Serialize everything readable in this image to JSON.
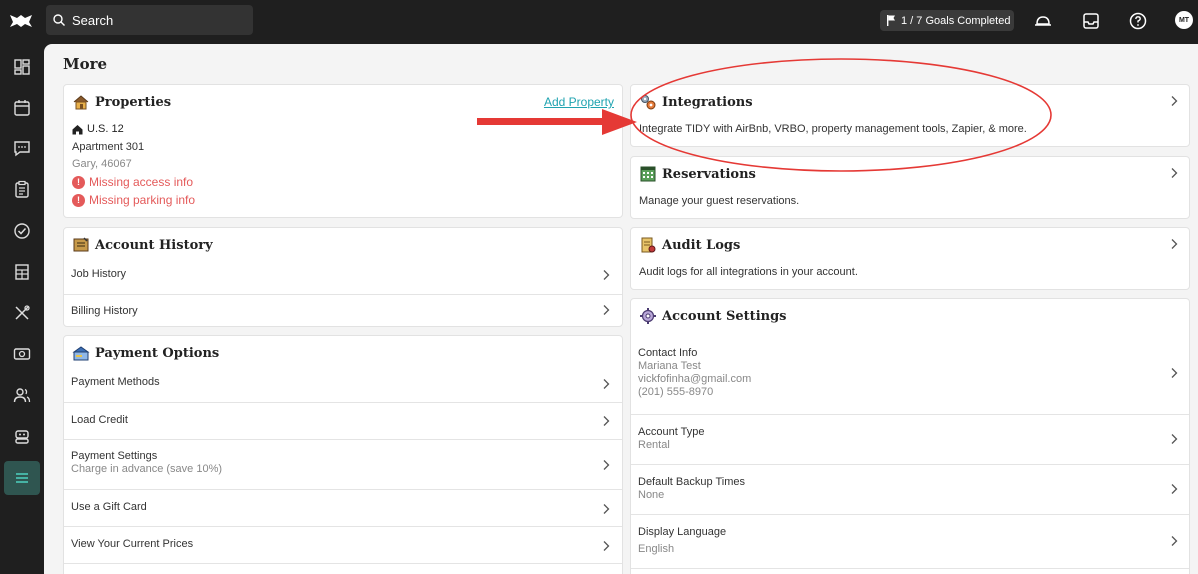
{
  "topbar": {
    "search_label": "Search",
    "goals_label": "1 / 7 Goals Completed",
    "avatar_initials": "MT",
    "icons": [
      "bell-icon",
      "inbox-icon",
      "help-icon"
    ]
  },
  "sidebar": {
    "items": [
      "dashboard-icon",
      "calendar-icon",
      "messages-icon",
      "clipboard-icon",
      "checkmark-icon",
      "building-icon",
      "tools-icon",
      "money-icon",
      "users-icon",
      "robot-icon",
      "menu-icon"
    ],
    "active": "menu-icon"
  },
  "page": {
    "title": "More"
  },
  "properties": {
    "title": "Properties",
    "add_link": "Add Property",
    "name": "U.S. 12",
    "line2": "Apartment 301",
    "line3": "Gary, 46067",
    "warn1": "Missing access info",
    "warn2": "Missing parking info"
  },
  "account_history": {
    "title": "Account History",
    "rows": [
      "Job History",
      "Billing History"
    ]
  },
  "payment_options": {
    "title": "Payment Options",
    "rows": [
      {
        "label": "Payment Methods",
        "sub": ""
      },
      {
        "label": "Load Credit",
        "sub": ""
      },
      {
        "label": "Payment Settings",
        "sub": "Charge in advance (save 10%)"
      },
      {
        "label": "Use a Gift Card",
        "sub": ""
      },
      {
        "label": "View Your Current Prices",
        "sub": ""
      }
    ]
  },
  "integrations": {
    "title": "Integrations",
    "desc": "Integrate TIDY with AirBnb, VRBO, property management tools, Zapier, & more."
  },
  "reservations": {
    "title": "Reservations",
    "desc": "Manage your guest reservations."
  },
  "audit_logs": {
    "title": "Audit Logs",
    "desc": "Audit logs for all integrations in your account."
  },
  "account_settings": {
    "title": "Account Settings",
    "contact": {
      "label": "Contact Info",
      "name": "Mariana Test",
      "email": "vickfofinha@gmail.com",
      "phone": "(201) 555-8970"
    },
    "rows": [
      {
        "label": "Account Type",
        "sub": "Rental"
      },
      {
        "label": "Default Backup Times",
        "sub": "None"
      },
      {
        "label": "Display Language",
        "sub": "English"
      }
    ]
  },
  "annotation_colors": {
    "arrow": "#e53935",
    "ellipse": "#e53935",
    "accent": "#1fa3b0"
  }
}
